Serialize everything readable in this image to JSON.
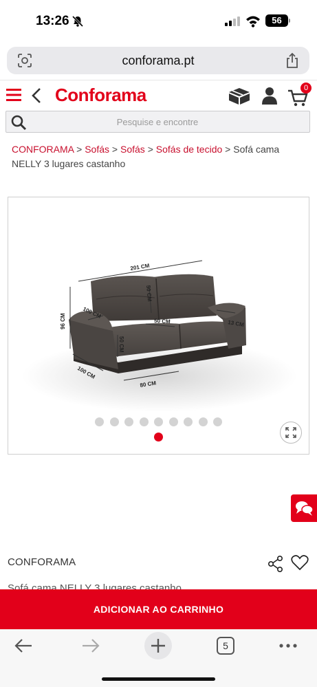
{
  "status_bar": {
    "time": "13:26",
    "battery": "56"
  },
  "browser": {
    "url": "conforama.pt",
    "open_tabs": "5"
  },
  "header": {
    "logo": "Conforama",
    "cart_count": "0"
  },
  "search": {
    "placeholder": "Pesquise e encontre"
  },
  "breadcrumb": {
    "items": [
      "CONFORAMA",
      "Sofás",
      "Sofás",
      "Sofás de tecido"
    ],
    "separator": ">",
    "current": "Sofá cama NELLY 3 lugares castanho"
  },
  "gallery": {
    "dimensions": {
      "width": "201 CM",
      "height": "96 CM",
      "depth": "100 CM",
      "seat_width": "80 CM",
      "backrest": "50 CM",
      "seat_depth": "50 CM",
      "seat_height": "50 CM",
      "arm_depth": "100 CM",
      "arm_width": "13 CM"
    },
    "total_images": 10,
    "active_index": 9
  },
  "product": {
    "brand": "CONFORAMA",
    "title": "Sofá cama NELLY 3 lugares castanho",
    "add_to_cart_label": "ADICIONAR AO CARRINHO"
  },
  "colors": {
    "brand_red": "#e2001a",
    "link_red": "#c8102e",
    "sofa": "#4a4541"
  }
}
